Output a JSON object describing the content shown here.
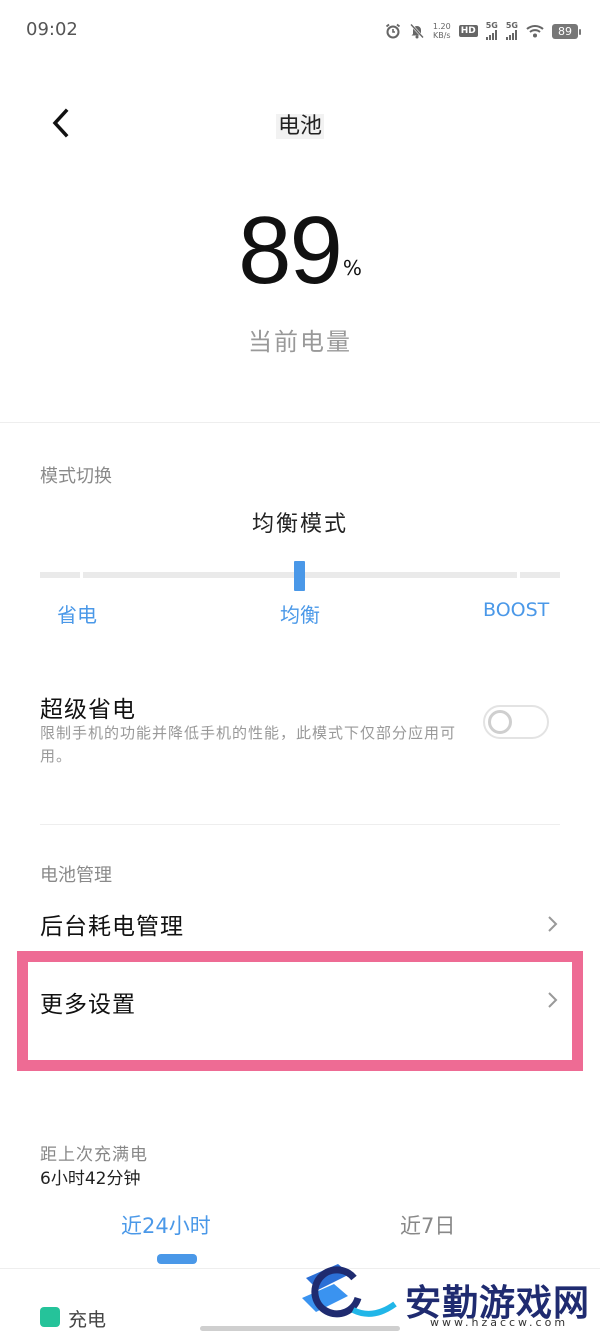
{
  "status_bar": {
    "time": "09:02",
    "net_speed_value": "1.20",
    "net_speed_unit": "KB/s",
    "hd_label": "HD",
    "sim1_label": "5G",
    "sim2_label": "5G",
    "battery": "89"
  },
  "header": {
    "title": "电池"
  },
  "battery": {
    "percent": "89",
    "percent_sign": "%",
    "caption": "当前电量"
  },
  "mode": {
    "section_label": "模式切换",
    "current_label": "均衡模式",
    "options": [
      "省电",
      "均衡",
      "BOOST"
    ],
    "slider_position_percent": 50
  },
  "super_saver": {
    "title": "超级省电",
    "description": "限制手机的功能并降低手机的性能，此模式下仅部分应用可用。",
    "enabled": false
  },
  "battery_management": {
    "section_label": "电池管理",
    "items": [
      {
        "label": "后台耗电管理"
      },
      {
        "label": "更多设置"
      }
    ]
  },
  "since_full_charge": {
    "label": "距上次充满电",
    "value": "6小时42分钟"
  },
  "tabs": [
    {
      "label": "近24小时",
      "active": true
    },
    {
      "label": "近7日",
      "active": false
    }
  ],
  "legend": {
    "charging_label": "充电",
    "charging_color": "#25c39a"
  },
  "colors": {
    "accent": "#4a98e8",
    "highlight": "#ee6b94"
  },
  "watermark": {
    "text": "安勤游戏网",
    "url": "www.hzaccw.com"
  }
}
